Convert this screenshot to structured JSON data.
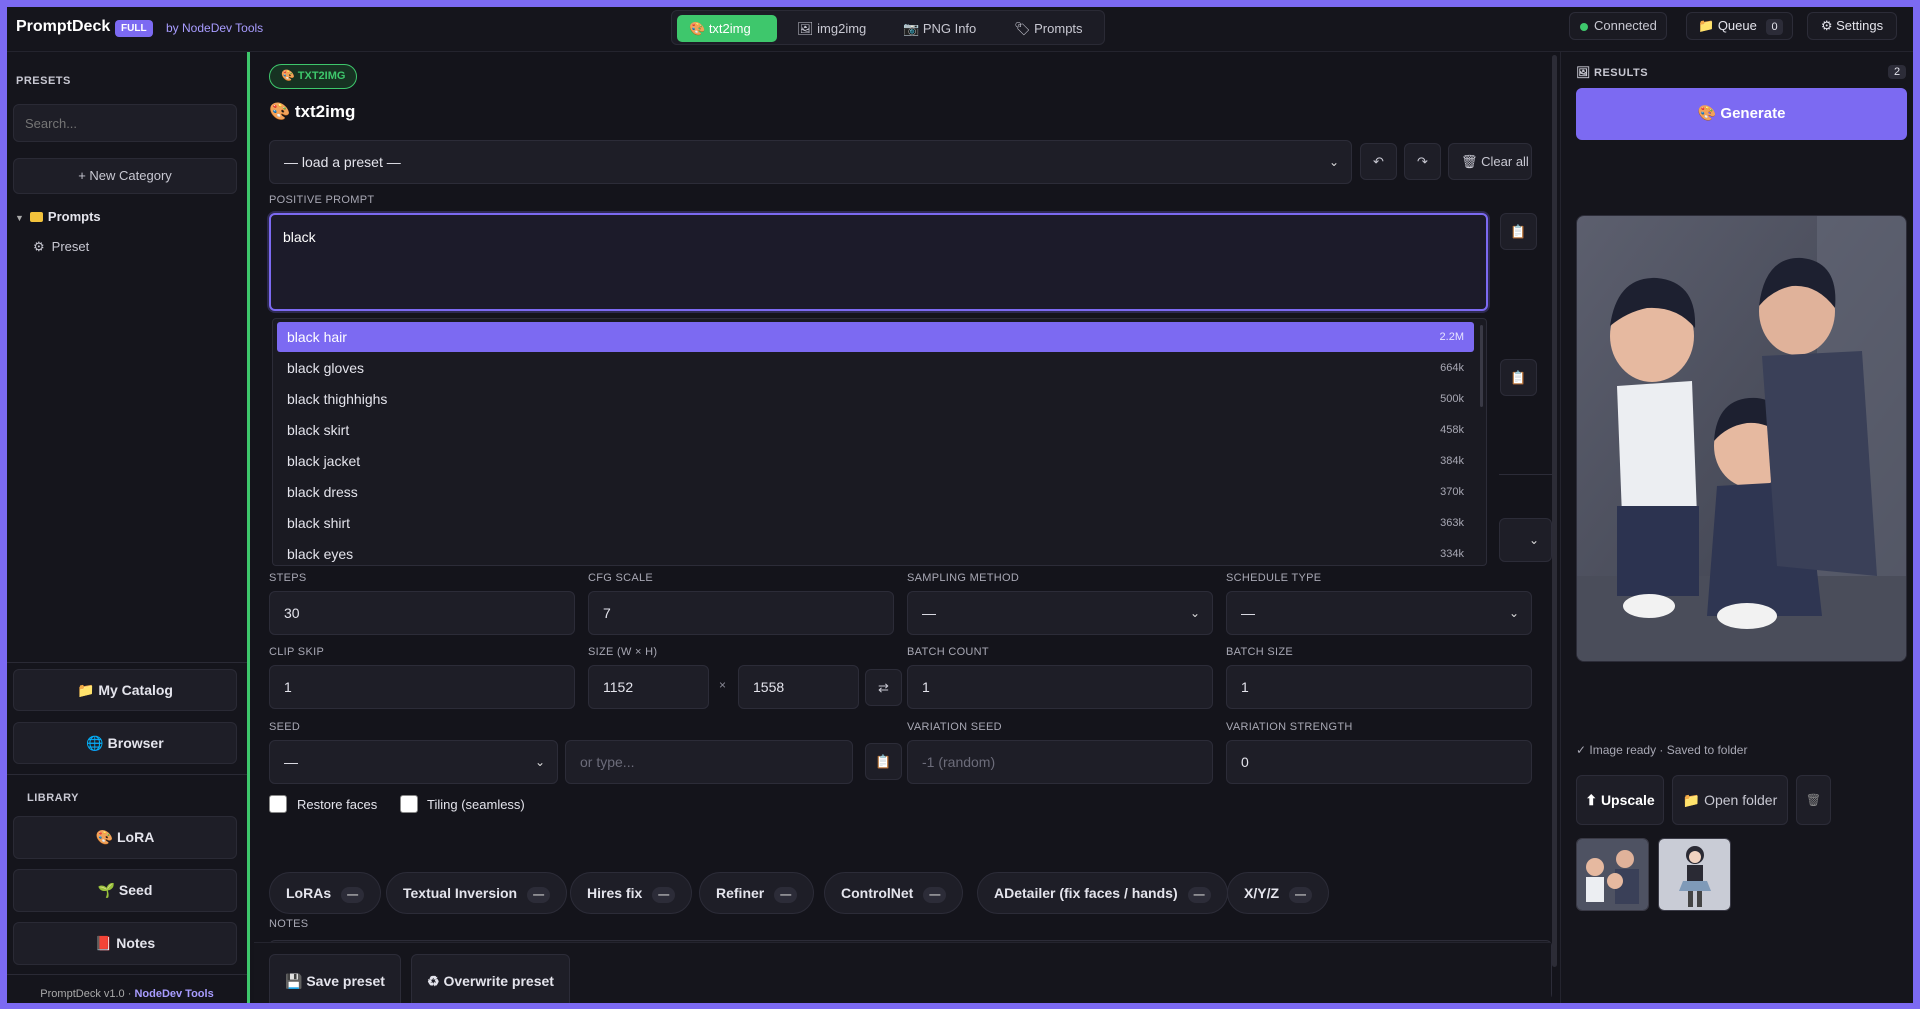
{
  "header": {
    "brand": "PromptDeck",
    "edition": "FULL",
    "byline": "by NodeDev Tools",
    "tabs": [
      {
        "icon": "🎨",
        "label": "txt2img"
      },
      {
        "icon": "🖼",
        "label": "img2img"
      },
      {
        "icon": "📷",
        "label": "PNG Info"
      },
      {
        "icon": "🏷",
        "label": "Prompts"
      }
    ],
    "status": "Connected",
    "queue_label": "Queue",
    "queue_count": "0",
    "settings_label": "⚙ Settings"
  },
  "sidebar": {
    "presets_heading": "PRESETS",
    "search_placeholder": "Search...",
    "new_category": "+ New Category",
    "tree_folder": "Prompts",
    "tree_item": "Preset",
    "my_catalog": "My Catalog",
    "browser": "Browser",
    "library_heading": "LIBRARY",
    "library": [
      "LoRA",
      "Seed",
      "Notes"
    ],
    "footer_version": "PromptDeck v1.0 · ",
    "footer_vendor": "NodeDev Tools"
  },
  "main": {
    "mode_pill": "TXT2IMG",
    "title": "txt2img",
    "preset_select": "— load a preset —",
    "clear_all": "Clear all",
    "positive_label": "POSITIVE PROMPT",
    "positive_value": "black",
    "autocomplete": [
      {
        "tag": "black hair",
        "count": "2.2M"
      },
      {
        "tag": "black gloves",
        "count": "664k"
      },
      {
        "tag": "black thighhighs",
        "count": "500k"
      },
      {
        "tag": "black skirt",
        "count": "458k"
      },
      {
        "tag": "black jacket",
        "count": "384k"
      },
      {
        "tag": "black dress",
        "count": "370k"
      },
      {
        "tag": "black shirt",
        "count": "363k"
      },
      {
        "tag": "black eyes",
        "count": "334k"
      }
    ],
    "steps_label": "STEPS",
    "steps": "30",
    "cfg_label": "CFG SCALE",
    "cfg": "7",
    "sampler_label": "SAMPLING METHOD",
    "sampler": "—",
    "schedule_label": "SCHEDULE TYPE",
    "schedule": "—",
    "clip_label": "CLIP SKIP",
    "clip": "1",
    "size_label": "SIZE (W × H)",
    "width": "1152",
    "height": "1558",
    "times": "×",
    "batch_count_label": "BATCH COUNT",
    "batch_count": "1",
    "batch_size_label": "BATCH SIZE",
    "batch_size": "1",
    "seed_label": "SEED",
    "seed_select": "—",
    "seed_placeholder": "or type...",
    "var_seed_label": "VARIATION SEED",
    "var_seed_placeholder": "-1 (random)",
    "var_strength_label": "VARIATION STRENGTH",
    "var_strength": "0",
    "restore_faces": "Restore faces",
    "tiling": "Tiling (seamless)",
    "chips": [
      "LoRAs",
      "Textual Inversion",
      "Hires fix",
      "Refiner",
      "ControlNet",
      "ADetailer (fix faces / hands)",
      "X/Y/Z"
    ],
    "chip_marker": "—",
    "notes_label": "NOTES",
    "save_preset": "Save preset",
    "overwrite_preset": "Overwrite preset"
  },
  "results": {
    "heading": "RESULTS",
    "count": "2",
    "generate": "Generate",
    "status": "✓ Image ready · Saved to folder",
    "upscale": "⬆ Upscale",
    "open_folder": "Open folder"
  }
}
